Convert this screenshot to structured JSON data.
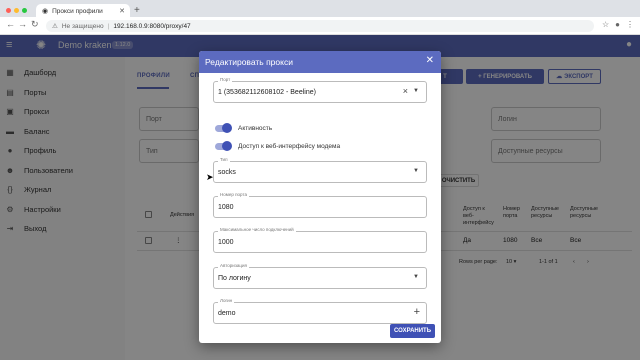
{
  "browser": {
    "tab_title": "Прокси профили",
    "new_tab": "+",
    "insecure_label": "Не защищено",
    "url": "192.168.0.9:8080/proxy/47"
  },
  "appbar": {
    "title": "Demo kraken",
    "version": "1.12.0"
  },
  "sidebar": {
    "items": [
      {
        "label": "Дашборд",
        "icon": "dashboard-icon"
      },
      {
        "label": "Порты",
        "icon": "ports-icon"
      },
      {
        "label": "Прокси",
        "icon": "proxy-icon"
      },
      {
        "label": "Баланс",
        "icon": "balance-icon"
      },
      {
        "label": "Профиль",
        "icon": "profile-icon"
      },
      {
        "label": "Пользователи",
        "icon": "users-icon"
      },
      {
        "label": "Журнал",
        "icon": "log-icon"
      },
      {
        "label": "Настройки",
        "icon": "settings-icon"
      },
      {
        "label": "Выход",
        "icon": "logout-icon"
      }
    ]
  },
  "main": {
    "tabs": [
      "ПРОФИЛИ",
      "СП"
    ],
    "buttons": {
      "add": "Т",
      "generate": "+ ГЕНЕРИРОВАТЬ",
      "export": "ЭКСПОРТ"
    },
    "filters": {
      "port": "Порт",
      "type": "Тип",
      "login": "Логин",
      "resources": "Доступные ресурсы"
    },
    "clear_button": "ОЧИСТИТЬ",
    "table": {
      "headers": {
        "actions": "Действия",
        "web": "Доступ к веб-интерфейсу",
        "port_num": "Номер порта",
        "available": "Доступные ресурсы",
        "available2": "Доступные ресурсы"
      },
      "row": {
        "web": "Да",
        "port_num": "1080",
        "available": "Все",
        "available2": "Все"
      }
    },
    "footer": {
      "rows_per_page_label": "Rows per page:",
      "rows_per_page": "10",
      "range": "1-1 of 1"
    }
  },
  "modal": {
    "title": "Редактировать прокси",
    "port": {
      "label": "Порт",
      "value": "1 (353682112608102 - Beeline)"
    },
    "toggle_active": "Активность",
    "toggle_web": "Доступ к веб-интерфейсу модема",
    "type": {
      "label": "Тип",
      "value": "socks"
    },
    "port_number": {
      "label": "Номер порта",
      "value": "1080"
    },
    "max_connections": {
      "label": "Максимальное число подключений",
      "value": "1000"
    },
    "auth": {
      "label": "Авторизация",
      "value": "По логину"
    },
    "login": {
      "label": "Логин",
      "value": "demo"
    },
    "save": "СОХРАНИТЬ"
  },
  "colors": {
    "primary": "#5c6bc0",
    "primary_dark": "#3f51b5"
  }
}
